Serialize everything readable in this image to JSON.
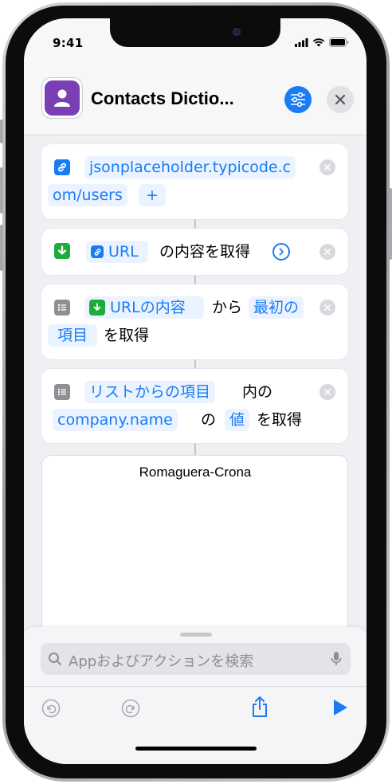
{
  "status_bar": {
    "time": "9:41"
  },
  "header": {
    "title": "Contacts Dictio..."
  },
  "actions": [
    {
      "url_line1": "jsonplaceholder.typicode.c",
      "url_line2": "om/users",
      "add": "+"
    },
    {
      "variable": "URL",
      "text": "の内容を取得"
    },
    {
      "variable": "URLの内容",
      "from": "から",
      "option_line1": "最初の",
      "option_line2": "項目",
      "text": "を取得"
    },
    {
      "variable": "リストからの項目",
      "in": "内の",
      "key": "company.name",
      "of": "の",
      "option": "値",
      "text": "を取得"
    }
  ],
  "result": {
    "text": "Romaguera-Crona"
  },
  "search": {
    "placeholder": "Appおよびアクションを検索"
  },
  "colors": {
    "accent": "#1a7cf5",
    "green": "#1faa3b",
    "purple": "#7b3fb5",
    "token_bg": "#eaf3ff"
  },
  "icons": [
    "link-icon",
    "download-icon",
    "list-icon",
    "person-icon",
    "sliders-icon",
    "close-icon",
    "chevron-right-icon",
    "search-icon",
    "mic-icon",
    "undo-icon",
    "redo-icon",
    "share-icon",
    "play-icon"
  ]
}
